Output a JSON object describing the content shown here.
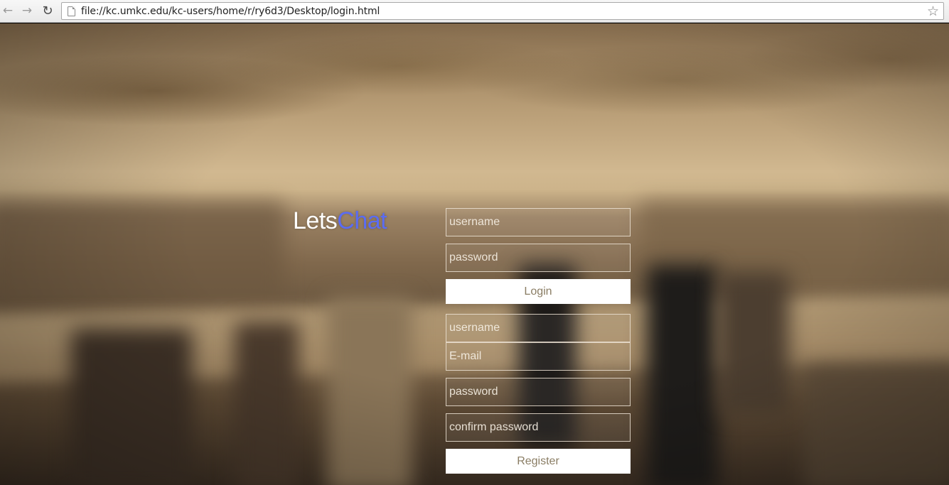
{
  "browser": {
    "url": "file://kc.umkc.edu/kc-users/home/r/ry6d3/Desktop/login.html",
    "back_icon": "←",
    "forward_icon": "→",
    "reload_icon": "↻",
    "bookmark_icon": "☆"
  },
  "logo": {
    "part1": "Lets",
    "part2": "Chat",
    "part1_color": "#ffffff",
    "part2_color": "#5b6cf2"
  },
  "login": {
    "username_placeholder": "username",
    "password_placeholder": "password",
    "button_label": "Login"
  },
  "register": {
    "username_placeholder": "username",
    "email_placeholder": "E-mail",
    "password_placeholder": "password",
    "confirm_placeholder": "confirm password",
    "button_label": "Register"
  }
}
